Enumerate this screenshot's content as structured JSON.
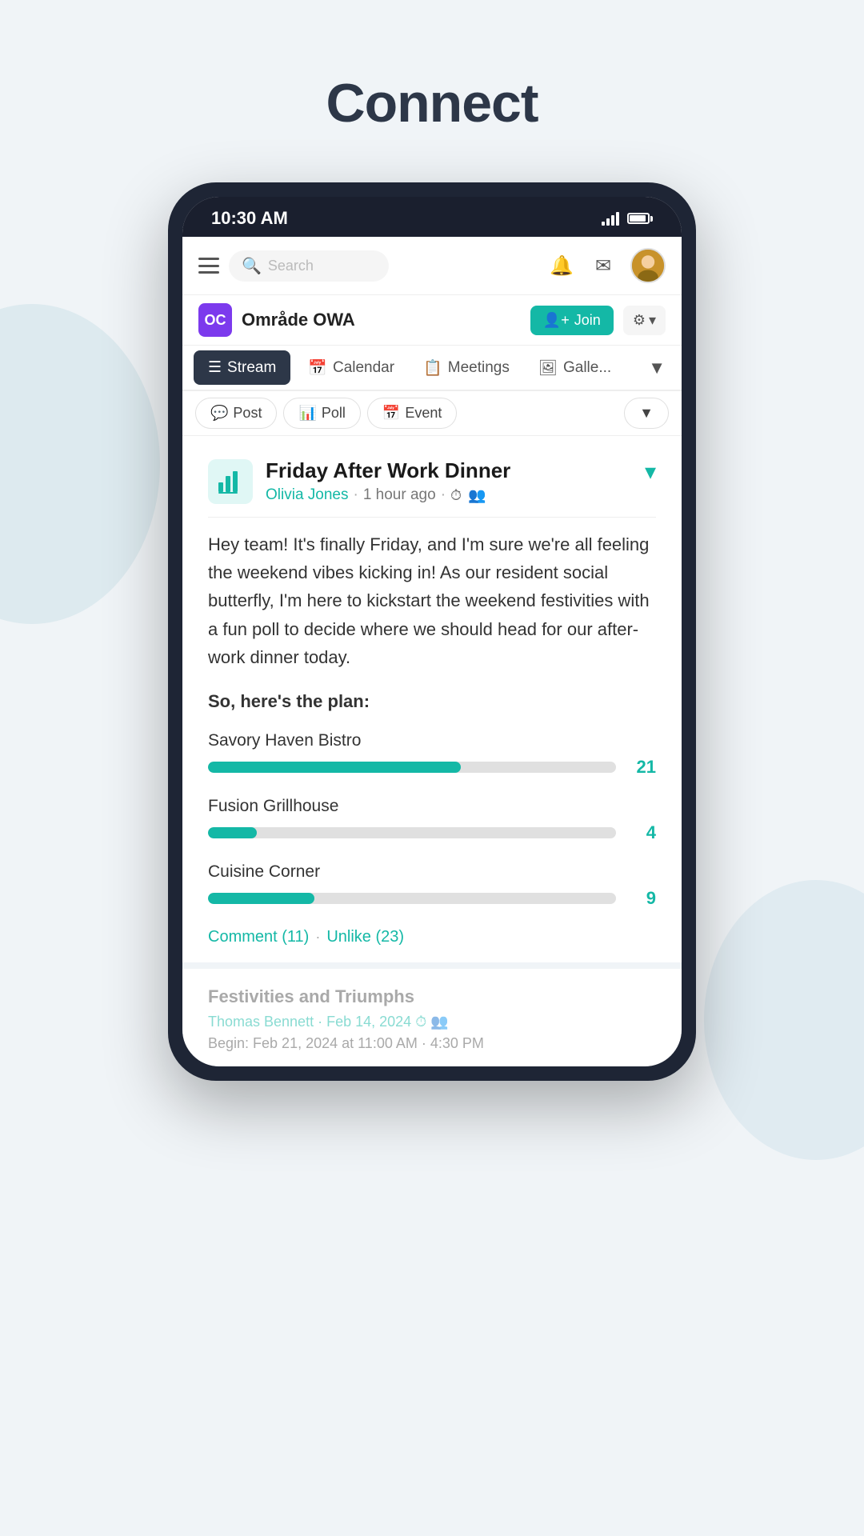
{
  "page": {
    "title": "Connect",
    "background": "#f0f4f7"
  },
  "statusBar": {
    "time": "10:30 AM",
    "signal": "signal-icon",
    "battery": "battery-icon"
  },
  "appHeader": {
    "searchPlaceholder": "Search",
    "menuIcon": "hamburger-menu",
    "notificationIcon": "bell-icon",
    "messageIcon": "envelope-icon",
    "avatarLabel": "User Avatar"
  },
  "community": {
    "iconLabel": "OC",
    "name": "Område OWA",
    "joinButton": "Join",
    "settingsButton": "⚙"
  },
  "navTabs": [
    {
      "label": "Stream",
      "icon": "stream-icon",
      "active": true
    },
    {
      "label": "Calendar",
      "icon": "calendar-icon",
      "active": false
    },
    {
      "label": "Meetings",
      "icon": "meetings-icon",
      "active": false
    },
    {
      "label": "Galle...",
      "icon": "gallery-icon",
      "active": false
    }
  ],
  "actionBar": {
    "postButton": "Post",
    "pollButton": "Poll",
    "eventButton": "Event",
    "moreButton": "▼"
  },
  "post": {
    "iconAlt": "bar-chart-icon",
    "title": "Friday After Work Dinner",
    "author": "Olivia Jones",
    "timeAgo": "1 hour ago",
    "clockIcon": "clock-icon",
    "groupIcon": "group-icon",
    "chevron": "▾",
    "body": "Hey team! It's finally Friday, and I'm sure we're all feeling the weekend vibes kicking in! As our resident social butterfly, I'm here to kickstart the weekend festivities with a fun poll to decide where we should head for our after-work dinner today.",
    "planHeading": "So, here's the plan:",
    "poll": {
      "options": [
        {
          "label": "Savory Haven Bistro",
          "count": 21,
          "pct": 62
        },
        {
          "label": "Fusion Grillhouse",
          "count": 4,
          "pct": 12
        },
        {
          "label": "Cuisine Corner",
          "count": 9,
          "pct": 26
        }
      ]
    },
    "commentBtn": "Comment (11)",
    "unlikeBtn": "Unlike (23)"
  },
  "partialPost": {
    "title": "Festivities and Triumphs",
    "author": "Thomas Bennett",
    "date": "Feb 14, 2024",
    "beginText": "Begin: Feb 21, 2024 at 11:00 AM · 4:30 PM"
  }
}
